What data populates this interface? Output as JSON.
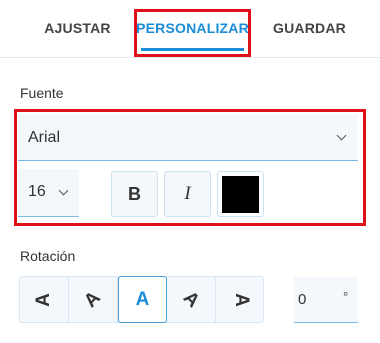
{
  "tabs": [
    {
      "label": "AJUSTAR"
    },
    {
      "label": "PERSONALIZAR"
    },
    {
      "label": "GUARDAR"
    }
  ],
  "font": {
    "label": "Fuente",
    "family": "Arial",
    "size": "16",
    "bold_label": "B",
    "italic_label": "I",
    "color": "#000000"
  },
  "rotation": {
    "label": "Rotación",
    "options": [
      "A",
      "A",
      "A",
      "A",
      "A"
    ],
    "value": "0",
    "unit": "°"
  },
  "colors": {
    "accent": "#1a8cd8",
    "highlight": "#e0101b"
  }
}
